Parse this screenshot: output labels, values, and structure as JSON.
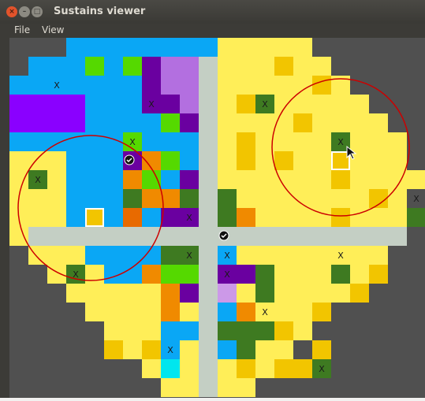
{
  "window": {
    "title": "Sustains viewer"
  },
  "menu": {
    "file": "File",
    "view": "View"
  },
  "icons": {
    "close": "close-icon",
    "minimize": "minimize-icon",
    "maximize": "maximize-icon",
    "check": "check-icon",
    "cursor": "cursor-icon"
  },
  "colors": {
    "background": "#505050",
    "blue": "#0aa7f5",
    "yellow": "#ffee58",
    "dark_yellow": "#f2c500",
    "dark_green": "#3e7a21",
    "light_green": "#55d900",
    "purple": "#6a00a0",
    "violet": "#8a00ff",
    "lavender": "#b36fe0",
    "orange": "#f08a00",
    "burnt_orange": "#e86a00",
    "cyan": "#00e6ee",
    "pink_lavender": "#cc99e8",
    "divider": "#c4cfc4",
    "circle": "#cc0000"
  },
  "markers": {
    "x_label": "X"
  }
}
